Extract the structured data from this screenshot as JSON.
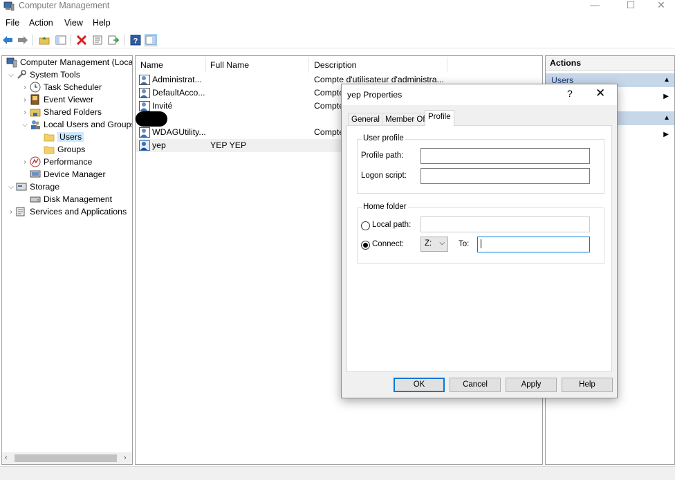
{
  "window": {
    "title": "Computer Management",
    "minimize": "—",
    "maximize": "☐",
    "close": "✕"
  },
  "menu": [
    "File",
    "Action",
    "View",
    "Help"
  ],
  "toolbar": [
    "back-icon",
    "forward-icon",
    "up-folder-icon",
    "show-hide-tree-icon",
    "delete-icon",
    "properties-icon",
    "export-list-icon",
    "help-icon",
    "action-pane-icon"
  ],
  "tree": {
    "root": "Computer Management (Local",
    "system_tools": "System Tools",
    "task_scheduler": "Task Scheduler",
    "event_viewer": "Event Viewer",
    "shared_folders": "Shared Folders",
    "local_users_groups": "Local Users and Groups",
    "users": "Users",
    "groups": "Groups",
    "performance": "Performance",
    "device_manager": "Device Manager",
    "storage": "Storage",
    "disk_management": "Disk Management",
    "services_apps": "Services and Applications"
  },
  "list": {
    "columns": [
      "Name",
      "Full Name",
      "Description"
    ],
    "rows": [
      {
        "name": "Administrat...",
        "full": "",
        "desc": "Compte d'utilisateur d'administra..."
      },
      {
        "name": "DefaultAcco...",
        "full": "",
        "desc": "Compte"
      },
      {
        "name": "Invité",
        "full": "",
        "desc": "Compte"
      },
      {
        "name": "",
        "full": "",
        "desc": ""
      },
      {
        "name": "WDAGUtility...",
        "full": "",
        "desc": "Compte"
      },
      {
        "name": "yep",
        "full": "YEP YEP",
        "desc": ""
      }
    ]
  },
  "actions": {
    "header": "Actions",
    "section1": "Users"
  },
  "dialog": {
    "title": "yep Properties",
    "help": "?",
    "close": "✕",
    "tabs": [
      "General",
      "Member Of",
      "Profile"
    ],
    "user_profile_group": "User profile",
    "profile_path_label": "Profile path:",
    "profile_path_value": "",
    "logon_script_label": "Logon script:",
    "logon_script_value": "",
    "home_folder_group": "Home folder",
    "local_path_label": "Local path:",
    "local_path_value": "",
    "connect_label": "Connect:",
    "drive_value": "Z:",
    "to_label": "To:",
    "to_value": "",
    "ok": "OK",
    "cancel": "Cancel",
    "apply": "Apply",
    "help_button": "Help"
  }
}
